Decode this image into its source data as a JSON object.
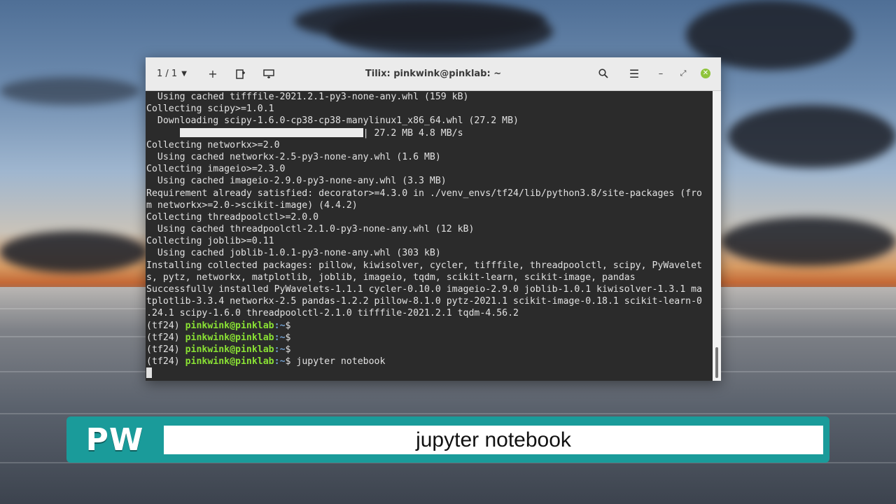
{
  "window": {
    "session": "1 / 1",
    "title": "Tilix: pinkwink@pinklab: ~"
  },
  "terminal": {
    "lines": [
      "  Using cached tifffile-2021.2.1-py3-none-any.whl (159 kB)",
      "Collecting scipy>=1.0.1",
      "  Downloading scipy-1.6.0-cp38-cp38-manylinux1_x86_64.whl (27.2 MB)",
      "| 27.2 MB 4.8 MB/s",
      "Collecting networkx>=2.0",
      "  Using cached networkx-2.5-py3-none-any.whl (1.6 MB)",
      "Collecting imageio>=2.3.0",
      "  Using cached imageio-2.9.0-py3-none-any.whl (3.3 MB)",
      "Requirement already satisfied: decorator>=4.3.0 in ./venv_envs/tf24/lib/python3.8/site-packages (fro",
      "m networkx>=2.0->scikit-image) (4.4.2)",
      "Collecting threadpoolctl>=2.0.0",
      "  Using cached threadpoolctl-2.1.0-py3-none-any.whl (12 kB)",
      "Collecting joblib>=0.11",
      "  Using cached joblib-1.0.1-py3-none-any.whl (303 kB)",
      "Installing collected packages: pillow, kiwisolver, cycler, tifffile, threadpoolctl, scipy, PyWavelet",
      "s, pytz, networkx, matplotlib, joblib, imageio, tqdm, scikit-learn, scikit-image, pandas",
      "Successfully installed PyWavelets-1.1.1 cycler-0.10.0 imageio-2.9.0 joblib-1.0.1 kiwisolver-1.3.1 ma",
      "tplotlib-3.3.4 networkx-2.5 pandas-1.2.2 pillow-8.1.0 pytz-2021.1 scikit-image-0.18.1 scikit-learn-0",
      ".24.1 scipy-1.6.0 threadpoolctl-2.1.0 tifffile-2021.2.1 tqdm-4.56.2"
    ],
    "progress_fraction": 1.0,
    "prompt_env": "(tf24) ",
    "prompt_user": "pinkwink@pinklab",
    "prompt_path": ":~",
    "prompt_symbol": "$ ",
    "command": "jupyter notebook"
  },
  "caption": {
    "logo": "PW",
    "text": "jupyter notebook"
  },
  "colors": {
    "caption_teal": "#1a9b9a",
    "prompt_green": "#8ae234",
    "close_green": "#8fc43b"
  }
}
